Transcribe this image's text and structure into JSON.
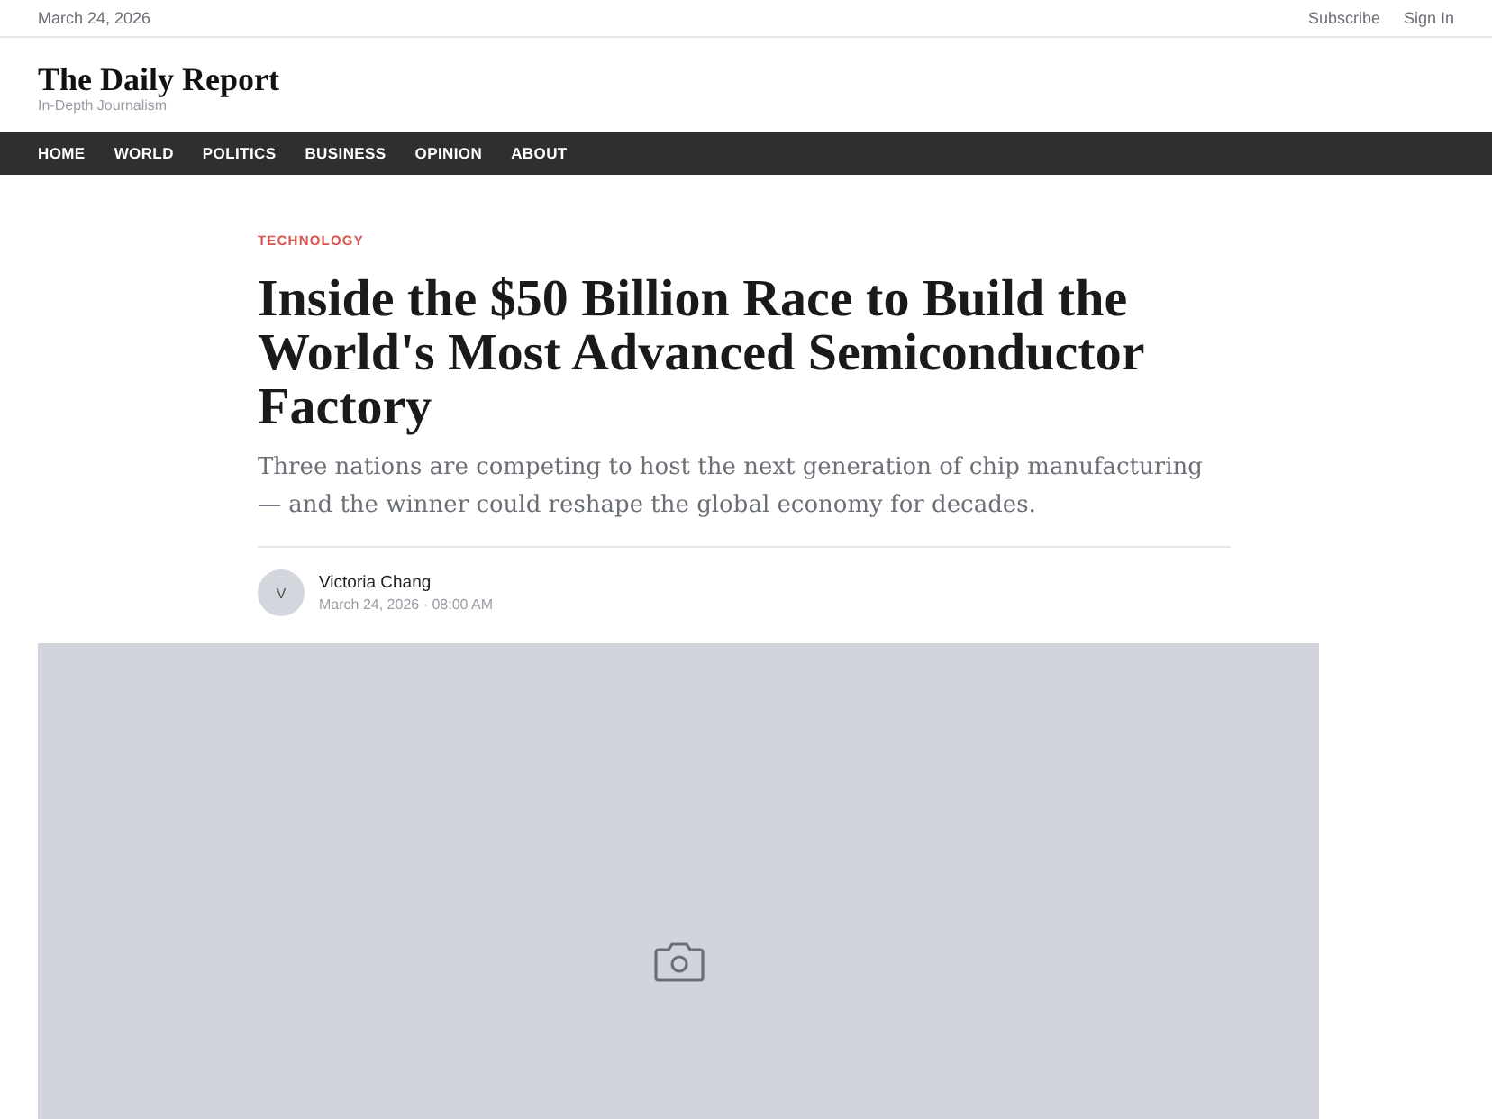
{
  "top_bar": {
    "date": "March 24, 2026",
    "links": [
      "Subscribe",
      "Sign In"
    ]
  },
  "masthead": {
    "title": "The Daily Report",
    "tagline": "In-Depth Journalism"
  },
  "nav": [
    "HOME",
    "WORLD",
    "POLITICS",
    "BUSINESS",
    "OPINION",
    "ABOUT"
  ],
  "article": {
    "category": "TECHNOLOGY",
    "headline": "Inside the $50 Billion Race to Build the World's Most Advanced Semiconductor Factory",
    "dek": "Three nations are competing to host the next generation of chip manufacturing — and the winner could reshape the global economy for decades.",
    "author": {
      "initial": "V",
      "name": "Victoria Chang",
      "date": "March 24, 2026 · 08:00 AM"
    },
    "image": {
      "kind": "placeholder"
    }
  }
}
